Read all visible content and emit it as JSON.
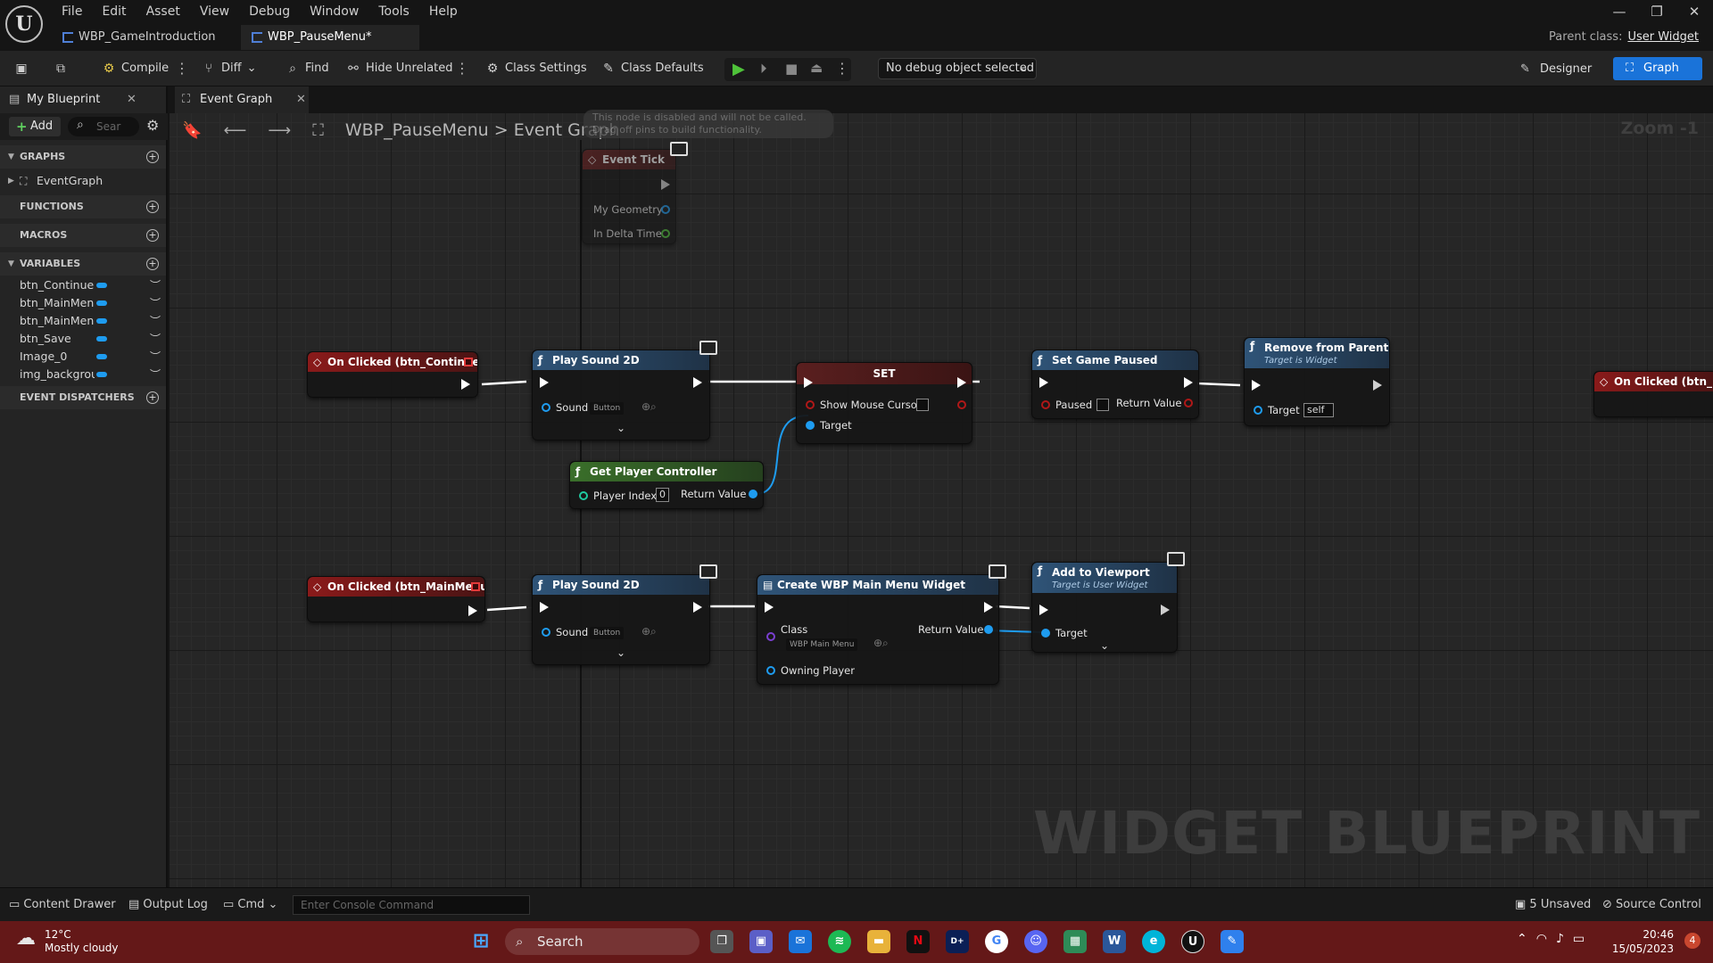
{
  "menu": [
    "File",
    "Edit",
    "Asset",
    "View",
    "Debug",
    "Window",
    "Tools",
    "Help"
  ],
  "tabs": [
    {
      "label": "WBP_GameIntroduction",
      "active": false
    },
    {
      "label": "WBP_PauseMenu*",
      "active": true
    }
  ],
  "parent_class": {
    "label": "Parent class:",
    "value": "User Widget"
  },
  "toolbar": {
    "compile": "Compile",
    "diff": "Diff",
    "find": "Find",
    "hide_unrelated": "Hide Unrelated",
    "class_settings": "Class Settings",
    "class_defaults": "Class Defaults",
    "debug_object": "No debug object selected",
    "designer": "Designer",
    "graph": "Graph"
  },
  "left_panel": {
    "tab": "My Blueprint",
    "add": "Add",
    "search_placeholder": "Sear",
    "sections": {
      "graphs": "GRAPHS",
      "functions": "FUNCTIONS",
      "macros": "MACROS",
      "variables": "VARIABLES",
      "event_dispatchers": "EVENT DISPATCHERS"
    },
    "graph_items": [
      "EventGraph"
    ],
    "variables": [
      "btn_Continue",
      "btn_MainMenu",
      "btn_MainMenu",
      "btn_Save",
      "Image_0",
      "img_background"
    ]
  },
  "graph": {
    "tab": "Event Graph",
    "breadcrumb_root": "WBP_PauseMenu",
    "breadcrumb_sep": ">",
    "breadcrumb_leaf": "Event Graph",
    "zoom": "Zoom -1",
    "watermark": "WIDGET BLUEPRINT",
    "disabled_tooltip_line1": "This node is disabled and will not be called.",
    "disabled_tooltip_line2": "Drag off pins to build functionality."
  },
  "nodes": {
    "event_tick": {
      "title": "Event Tick",
      "pin1": "My Geometry",
      "pin2": "In Delta Time"
    },
    "on_clicked_continue": {
      "title": "On Clicked (btn_Continue)"
    },
    "play_sound_1": {
      "title": "Play Sound 2D",
      "pin": "Sound",
      "value": "Button"
    },
    "set_node": {
      "title": "SET",
      "pin1": "Show Mouse Cursor",
      "pin2": "Target"
    },
    "set_game_paused": {
      "title": "Set Game Paused",
      "pin1": "Paused",
      "pin2": "Return Value"
    },
    "remove_from_parent": {
      "title": "Remove from Parent",
      "subtitle": "Target is Widget",
      "pin": "Target",
      "value": "self"
    },
    "on_clicked_main_partial": {
      "title": "On Clicked (btn_Ma"
    },
    "get_player_controller": {
      "title": "Get Player Controller",
      "pin1": "Player Index",
      "index": "0",
      "pin2": "Return Value"
    },
    "on_clicked_mainmenu": {
      "title": "On Clicked (btn_MainMenu)"
    },
    "play_sound_2": {
      "title": "Play Sound 2D",
      "pin": "Sound",
      "value": "Button"
    },
    "create_widget": {
      "title": "Create WBP Main Menu Widget",
      "pin1": "Class",
      "class_value": "WBP Main Menu",
      "pin2": "Return Value",
      "pin3": "Owning Player"
    },
    "add_to_viewport": {
      "title": "Add to Viewport",
      "subtitle": "Target is User Widget",
      "pin": "Target"
    }
  },
  "bottom": {
    "content_drawer": "Content Drawer",
    "output_log": "Output Log",
    "cmd": "Cmd",
    "console_placeholder": "Enter Console Command",
    "unsaved": "5 Unsaved",
    "source_control": "Source Control"
  },
  "taskbar": {
    "temperature": "12°C",
    "weather": "Mostly cloudy",
    "search": "Search",
    "time": "20:46",
    "date": "15/05/2023",
    "notifications": "4"
  },
  "colors": {
    "accent": "#1a73d9",
    "event_header": "#8a1a1a",
    "function_header": "#2f5478",
    "pure_header": "#3a6f2a",
    "taskbar": "#641818",
    "object_pin": "#1e9cf0",
    "bool_pin": "#b01818",
    "int_pin": "#1fc9a0"
  }
}
